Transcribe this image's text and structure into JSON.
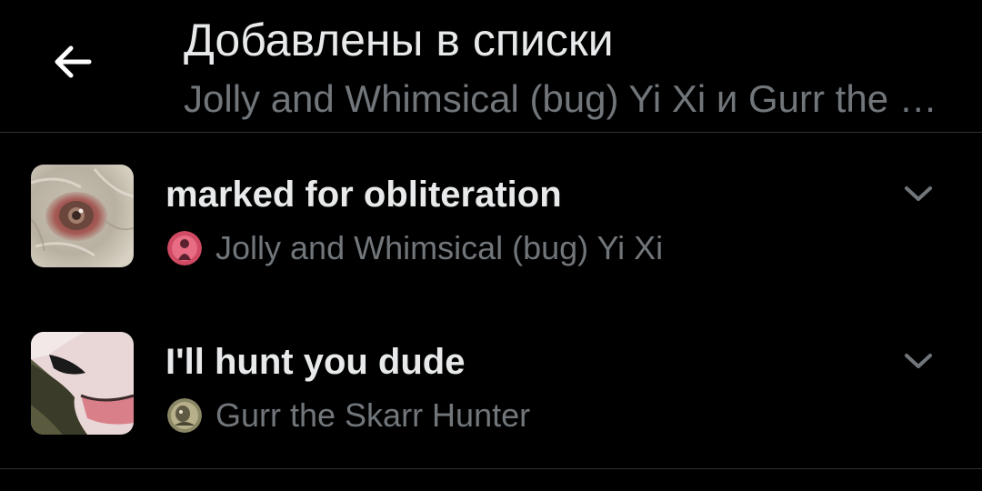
{
  "header": {
    "title": "Добавлены в списки",
    "subtitle": "Jolly and Whimsical (bug) Yi Xi и Gurr the Skarr Hunter"
  },
  "lists": [
    {
      "name": "marked for obliteration",
      "owner": "Jolly and Whimsical (bug) Yi Xi",
      "icon": "chevron-down-icon"
    },
    {
      "name": "I'll hunt you dude",
      "owner": "Gurr the Skarr Hunter",
      "icon": "chevron-down-icon"
    }
  ],
  "colors": {
    "background": "#000000",
    "primary_text": "#e7e9ea",
    "secondary_text": "#71767b",
    "divider": "#2f3336"
  }
}
